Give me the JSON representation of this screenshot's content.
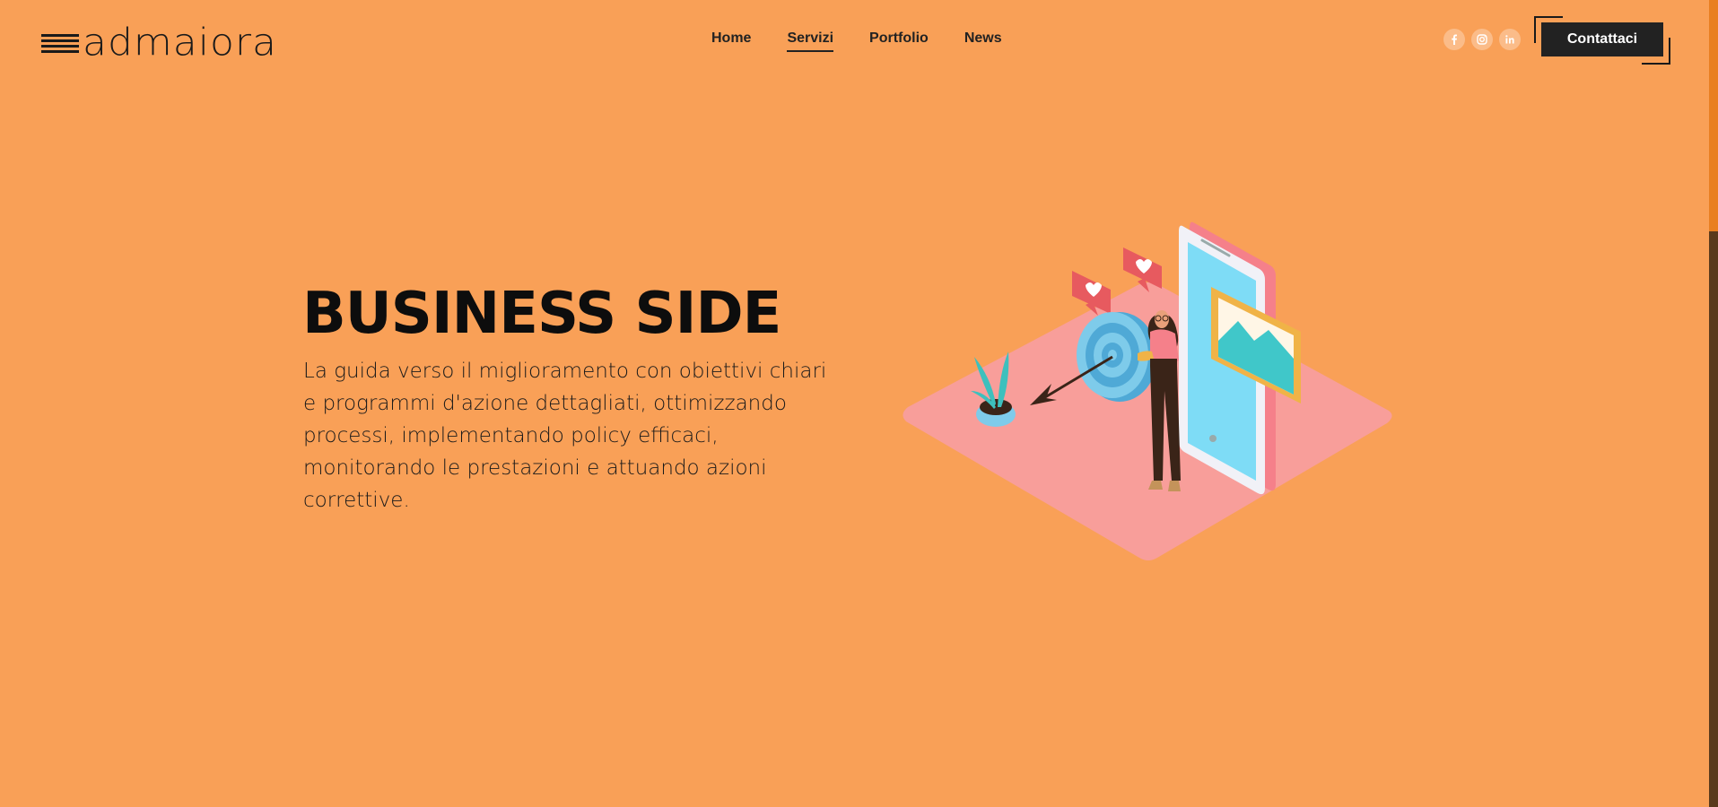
{
  "header": {
    "logo_text": "admaiora",
    "nav": [
      {
        "label": "Home",
        "active": false
      },
      {
        "label": "Servizi",
        "active": true
      },
      {
        "label": "Portfolio",
        "active": false
      },
      {
        "label": "News",
        "active": false
      }
    ],
    "socials": [
      {
        "name": "facebook-icon",
        "glyph": "f"
      },
      {
        "name": "instagram-icon",
        "glyph": ""
      },
      {
        "name": "linkedin-icon",
        "glyph": "in"
      }
    ],
    "contact_label": "Contattaci"
  },
  "hero": {
    "title": "BUSINESS SIDE",
    "description": "La guida verso il miglioramento con obiettivi chiari e programmi d'azione dettagliati, ottimizzando processi, implementando policy efficaci, monitorando le prestazioni e attuando azioni correttive."
  },
  "colors": {
    "background": "#F9A057",
    "button": "#222222",
    "platform": "#F89E9A",
    "phone_screen": "#7EDCF6",
    "scrollbar_track": "#E97F21",
    "scrollbar_thumb": "#5A3A1C"
  }
}
